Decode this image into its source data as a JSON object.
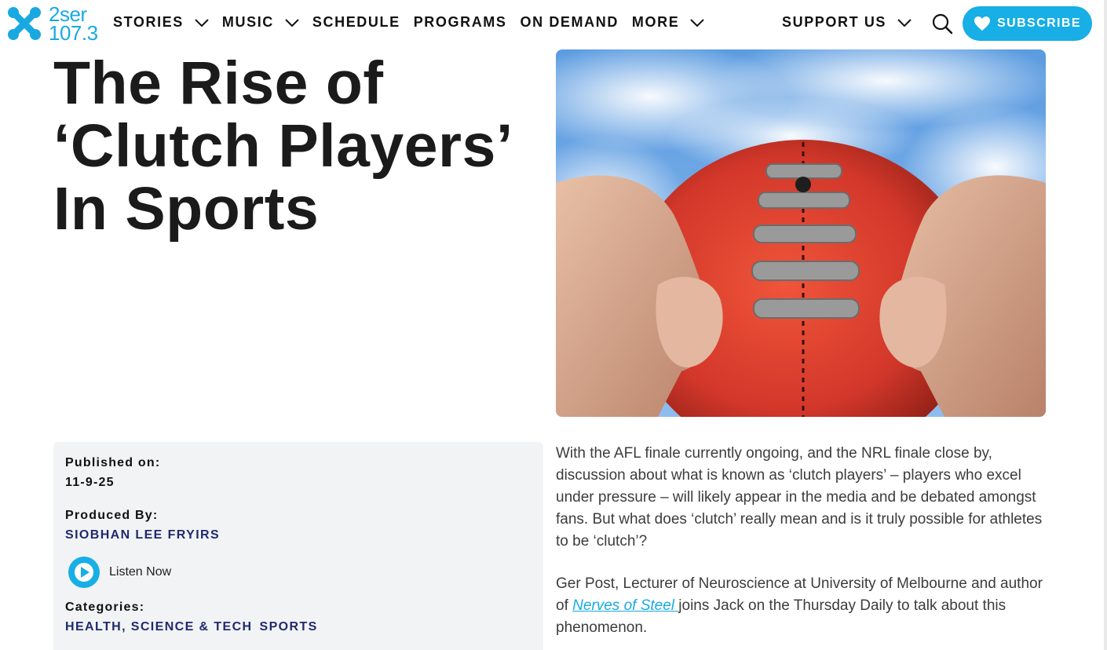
{
  "brand": {
    "logo_line1": "2ser",
    "logo_line2": "107.3",
    "accent_color": "#18aee6"
  },
  "nav": {
    "items": [
      {
        "label": "STORIES",
        "has_dropdown": true
      },
      {
        "label": "MUSIC",
        "has_dropdown": true
      },
      {
        "label": "SCHEDULE",
        "has_dropdown": false
      },
      {
        "label": "PROGRAMS",
        "has_dropdown": false
      },
      {
        "label": "ON DEMAND",
        "has_dropdown": false
      },
      {
        "label": "MORE",
        "has_dropdown": true
      }
    ],
    "support_label": "SUPPORT US",
    "search_icon": "search-icon",
    "subscribe_label": "SUBSCRIBE",
    "subscribe_icon": "heart-icon"
  },
  "article": {
    "title_line1": "The Rise of",
    "title_line2": "‘Clutch Players’",
    "title_line3": "In Sports",
    "image_icon": "football-photo",
    "published_label": "Published on:",
    "published_value": "11-9-25",
    "produced_label": "Produced By:",
    "producer": "SIOBHAN LEE FRYIRS",
    "listen_label": "Listen Now",
    "categories_label": "Categories:",
    "categories": [
      "HEALTH, SCIENCE & TECH",
      "SPORTS"
    ],
    "para1": "With the AFL finale currently ongoing, and the NRL finale close by, discussion about what is known as ‘clutch players’ – players who excel under pressure – will likely appear in the media and be debated amongst fans. But what does ‘clutch’ really mean and is it truly possible for athletes to be ‘clutch’?",
    "para2_before": "Ger Post, Lecturer of Neuroscience at University of Melbourne and author of ",
    "para2_link": "Nerves of Steel ",
    "para2_after": "joins Jack on the Thursday Daily to talk about this phenomenon."
  }
}
